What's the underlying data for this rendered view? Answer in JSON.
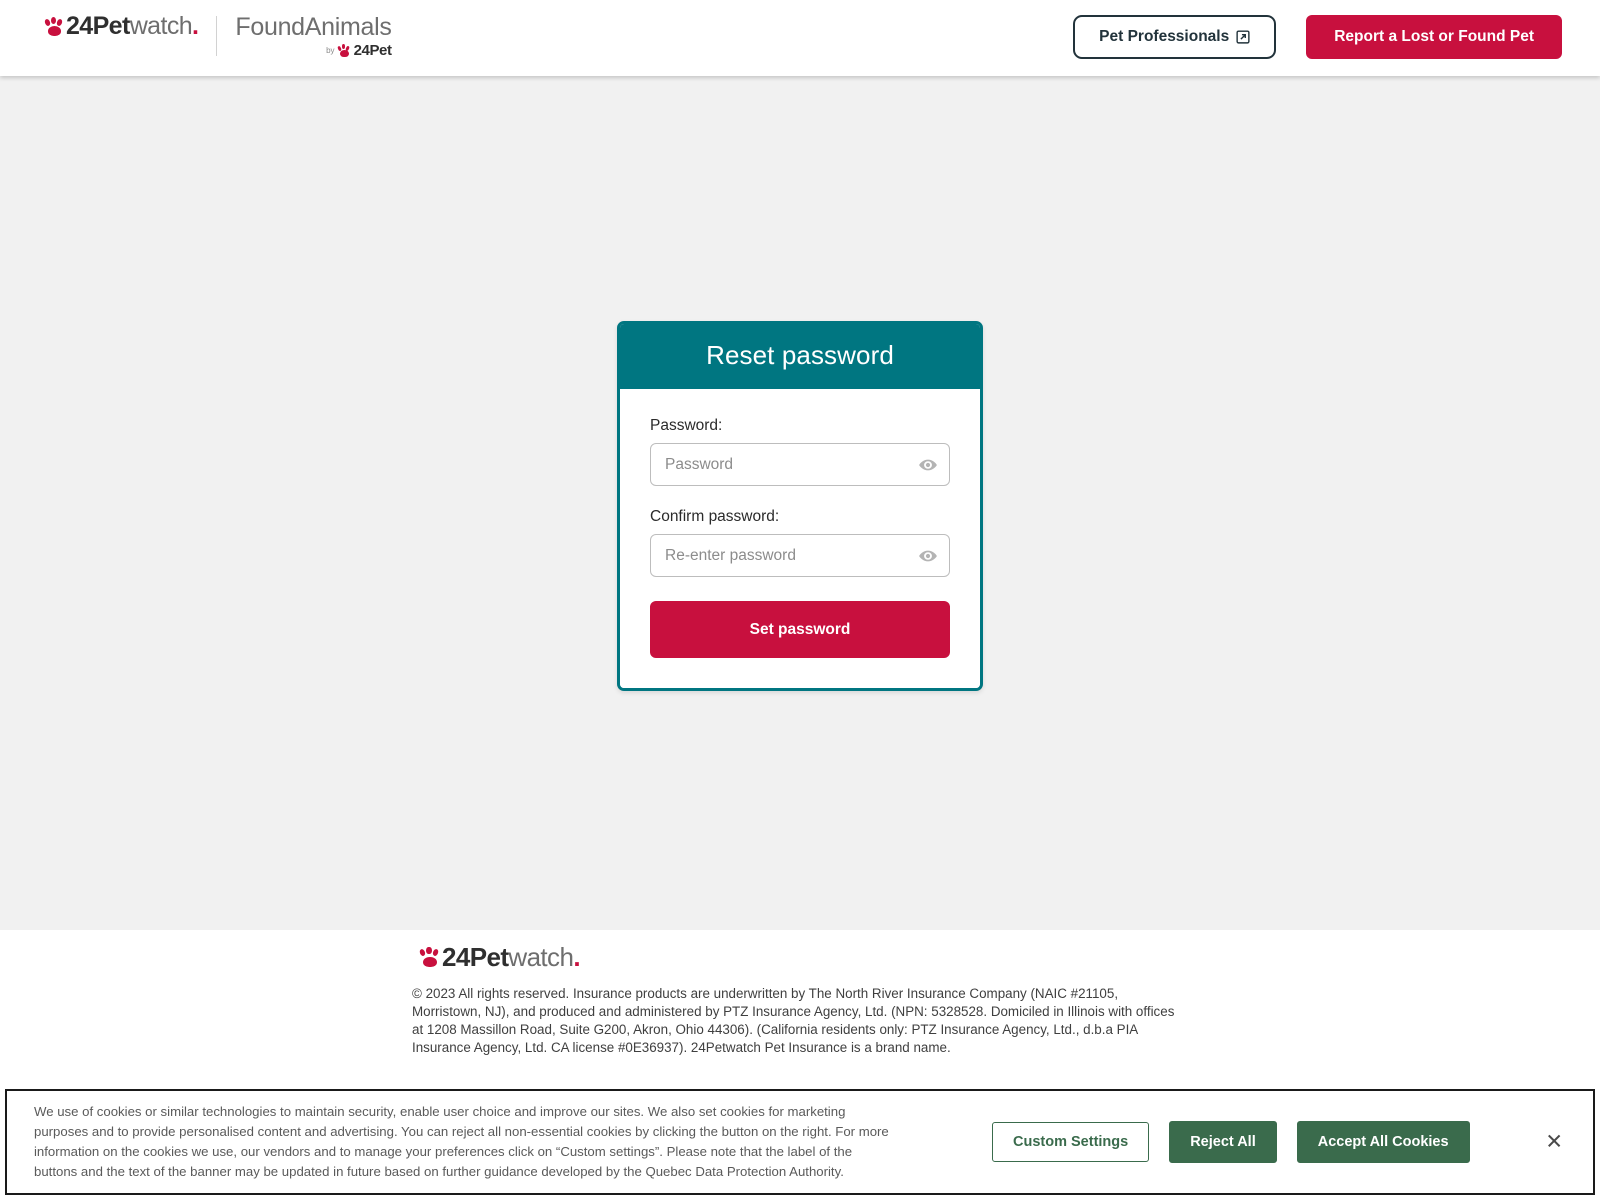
{
  "header": {
    "brand": {
      "logo_icon": "paw-icon",
      "wordmark_bold": "24Pet",
      "wordmark_light": "watch",
      "wordmark_dot": ".",
      "partner_title": "FoundAnimals",
      "partner_by": "by",
      "partner_brand": "24Pet"
    },
    "pet_professionals_label": "Pet Professionals",
    "pet_professionals_icon": "external-link-icon",
    "report_pet_label": "Report a Lost or Found Pet"
  },
  "card": {
    "title": "Reset password",
    "password_label": "Password:",
    "password_value": "",
    "password_placeholder": "Password",
    "password_toggle_icon": "eye-icon",
    "confirm_label": "Confirm password:",
    "confirm_value": "",
    "confirm_placeholder": "Re-enter password",
    "confirm_toggle_icon": "eye-icon",
    "submit_label": "Set password"
  },
  "footer": {
    "logo_icon": "paw-icon",
    "wordmark_bold": "24Pet",
    "wordmark_light": "watch",
    "wordmark_dot": ".",
    "legal_text": "© 2023 All rights reserved. Insurance products are underwritten by The North River Insurance Company (NAIC #21105, Morristown, NJ), and produced and administered by PTZ Insurance Agency, Ltd. (NPN: 5328528. Domiciled in Illinois with offices at 1208 Massillon Road, Suite G200, Akron, Ohio 44306). (California residents only: PTZ Insurance Agency, Ltd., d.b.a PIA Insurance Agency, Ltd. CA license #0E36937). 24Petwatch Pet Insurance is a brand name."
  },
  "cookie_banner": {
    "text": "We use of cookies or similar technologies to maintain security, enable user choice and improve our sites. We also set cookies for marketing purposes and to provide personalised content and advertising. You can reject all non-essential cookies by clicking the button on the right. For more information on the cookies we use, our vendors and to manage your preferences click on “Custom settings”. Please note that the label of the buttons and the text of the banner may be updated in future based on further guidance developed by the Quebec Data Protection Authority.",
    "custom_settings_label": "Custom Settings",
    "reject_all_label": "Reject All",
    "accept_all_label": "Accept All Cookies",
    "close_icon": "close-icon",
    "close_glyph": "✕"
  },
  "colors": {
    "brand_crimson": "#C8103E",
    "brand_teal": "#007681",
    "page_background": "#f1f1f1",
    "cookie_green": "#3a6b4c",
    "header_outline": "#22333b"
  }
}
